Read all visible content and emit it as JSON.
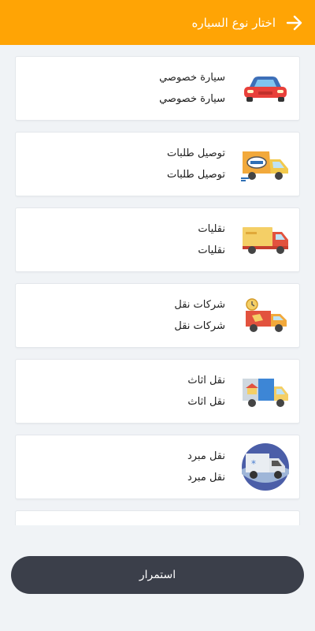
{
  "header": {
    "title": "اختار نوع السياره",
    "back_icon": "arrow-right-icon"
  },
  "colors": {
    "accent": "#ffa405",
    "button": "#3b3f4a",
    "background": "#f0f3f6"
  },
  "vehicles": [
    {
      "title": "سيارة خصوصي",
      "subtitle": "سيارة خصوصي",
      "icon": "private-car-icon"
    },
    {
      "title": "توصيل طلبات",
      "subtitle": "توصيل طلبات",
      "icon": "delivery-van-icon"
    },
    {
      "title": "نقليات",
      "subtitle": "نقليات",
      "icon": "truck-icon"
    },
    {
      "title": "شركات نقل",
      "subtitle": "شركات نقل",
      "icon": "transport-company-icon"
    },
    {
      "title": "نقل اثاث",
      "subtitle": "نقل اثاث",
      "icon": "furniture-truck-icon"
    },
    {
      "title": "نقل مبرد",
      "subtitle": "نقل مبرد",
      "icon": "refrigerated-truck-icon"
    }
  ],
  "continue_button": {
    "label": "استمرار"
  }
}
